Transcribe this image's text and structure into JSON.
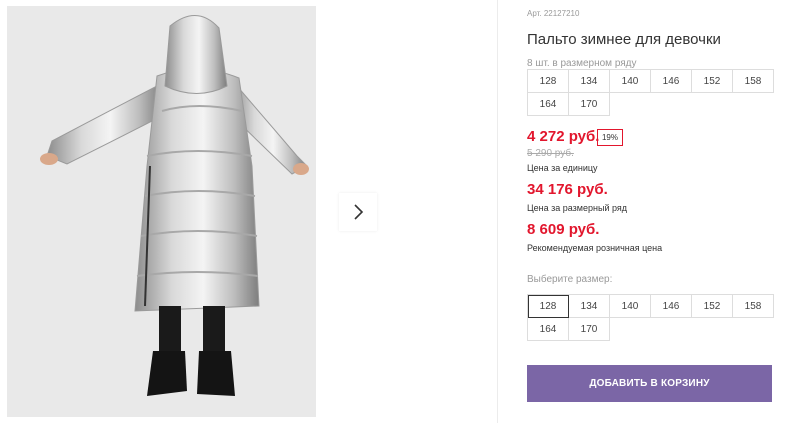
{
  "product": {
    "sku": "Арт. 22127210",
    "title": "Пальто зимнее для девочки",
    "pack_note": "8 шт. в размерном ряду",
    "pack_sizes": [
      "128",
      "134",
      "140",
      "146",
      "152",
      "158",
      "164",
      "170"
    ],
    "price": "4 272 руб.",
    "discount": "19%",
    "old_price": "5 290 руб.",
    "unit_price_label": "Цена за единицу",
    "pack_price": "34 176 руб.",
    "pack_price_label": "Цена за размерный ряд",
    "retail_price": "8 609 руб.",
    "retail_price_label": "Рекомендуемая розничная цена",
    "choose_size_label": "Выберите размер:",
    "sizes": [
      "128",
      "134",
      "140",
      "146",
      "152",
      "158",
      "164",
      "170"
    ],
    "selected_size": "128",
    "add_to_cart": "ДОБАВИТЬ В КОРЗИНУ"
  },
  "gallery": {
    "image_alt": "product-photo-silver-puffer-coat",
    "next_icon": "chevron-right-icon"
  },
  "colors": {
    "price_red": "#e2162d",
    "button_purple": "#7b66a6",
    "photo_background": "#e9e9e9"
  }
}
